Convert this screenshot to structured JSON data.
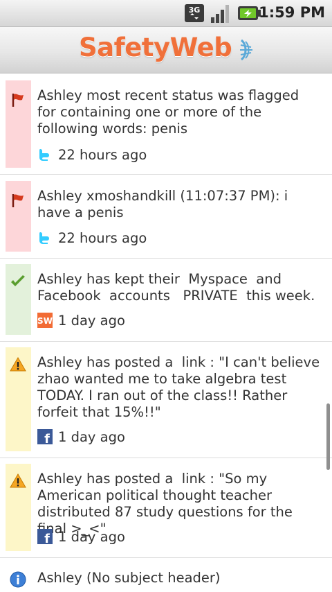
{
  "status_bar": {
    "network_icon": "3g-icon",
    "signal_icon": "signal-bars-icon",
    "battery_icon": "battery-charging-icon",
    "network_label": "3G",
    "time": "1:59 PM"
  },
  "header": {
    "logo_text": "SafetyWeb",
    "logo_color": "#f0703a"
  },
  "feed": {
    "items": [
      {
        "status": "flagged",
        "status_icon": "red-flag-icon",
        "color": "#fdd6d9",
        "text": "Ashley most recent status was flagged for containing one or more of the following words: penis",
        "source": "twitter",
        "source_icon": "twitter-icon",
        "time": "22 hours ago"
      },
      {
        "status": "flagged",
        "status_icon": "red-flag-icon",
        "color": "#fdd6d9",
        "text": "Ashley xmoshandkill (11:07:37 PM): i have a penis",
        "source": "twitter",
        "source_icon": "twitter-icon",
        "time": "22 hours ago"
      },
      {
        "status": "ok",
        "status_icon": "green-check-icon",
        "color": "#e3f1db",
        "text": "Ashley has kept their  Myspace  and Facebook  accounts   PRIVATE  this week.",
        "source": "safetyweb",
        "source_icon": "safetyweb-sw-icon",
        "source_label": "SW",
        "time": "1 day ago"
      },
      {
        "status": "warning",
        "status_icon": "warning-triangle-icon",
        "color": "#fdf6c8",
        "text": "Ashley has posted a  link : \"I can't believe zhao wanted me to take algebra test TODAY. I ran out of the class!! Rather forfeit that 15%!!\"",
        "source": "facebook",
        "source_icon": "facebook-icon",
        "source_label": "f",
        "time": "1 day ago"
      },
      {
        "status": "warning",
        "status_icon": "warning-triangle-icon",
        "color": "#fdf6c8",
        "text": "Ashley has posted a  link : \"So my American political thought teacher distributed 87 study questions for the final >_<\"",
        "source": "facebook",
        "source_icon": "facebook-icon",
        "source_label": "f",
        "time": "1 day ago"
      },
      {
        "status": "info",
        "status_icon": "info-circle-icon",
        "color": "#ffffff",
        "text": "Ashley (No subject header)"
      }
    ]
  }
}
